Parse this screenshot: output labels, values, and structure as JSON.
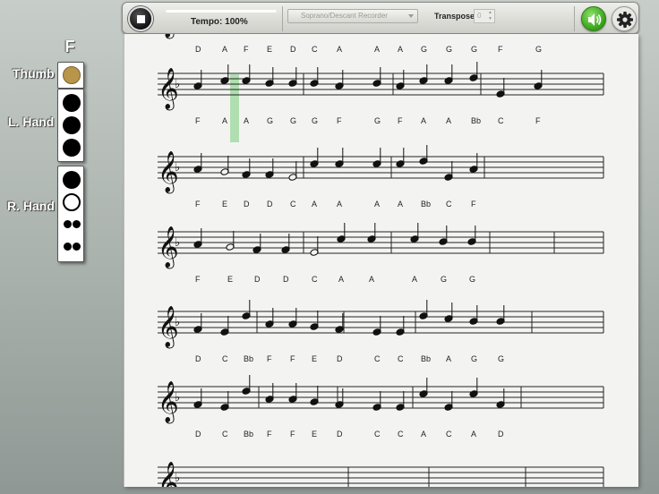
{
  "toolbar": {
    "tempo_label": "Tempo: 100%",
    "tempo_value": 1.0,
    "instrument": "Soprano/Descant Recorder",
    "transpose_label": "Transpose",
    "transpose_value": "0",
    "icons": {
      "stop": "stop-icon",
      "sound": "speaker-icon",
      "settings": "gear-icon"
    }
  },
  "fingering": {
    "note": "F",
    "thumb_label": "Thumb",
    "left_hand_label": "L. Hand",
    "right_hand_label": "R. Hand",
    "thumb": "partial",
    "left_hand": [
      "closed",
      "closed",
      "closed"
    ],
    "right_hand": [
      "closed",
      "open",
      "double-closed",
      "double-closed"
    ],
    "colors": {
      "thumb_partial": "#b8954a",
      "closed": "#000000",
      "open": "#ffffff"
    }
  },
  "sheet": {
    "key_signature": "F major (one flat)",
    "systems": [
      {
        "letters": [
          "D",
          "A",
          "F",
          "E",
          "D",
          "C",
          "A",
          "A",
          "A",
          "G",
          "G",
          "G",
          "F",
          "G"
        ]
      },
      {
        "letters": [
          "F",
          "A",
          "A",
          "G",
          "G",
          "G",
          "F",
          "G",
          "F",
          "A",
          "A",
          "Bb",
          "C",
          "F"
        ]
      },
      {
        "letters": [
          "F",
          "E",
          "D",
          "D",
          "C",
          "A",
          "A",
          "A",
          "A",
          "Bb",
          "C",
          "F"
        ]
      },
      {
        "letters": [
          "F",
          "E",
          "D",
          "D",
          "C",
          "A",
          "A",
          "A",
          "G",
          "G"
        ]
      },
      {
        "letters": [
          "D",
          "C",
          "Bb",
          "F",
          "F",
          "E",
          "D",
          "C",
          "C",
          "Bb",
          "A",
          "G",
          "G"
        ]
      },
      {
        "letters": [
          "D",
          "C",
          "Bb",
          "F",
          "F",
          "E",
          "D",
          "C",
          "C",
          "A",
          "C",
          "A",
          "D"
        ]
      },
      {
        "letters": []
      }
    ]
  }
}
